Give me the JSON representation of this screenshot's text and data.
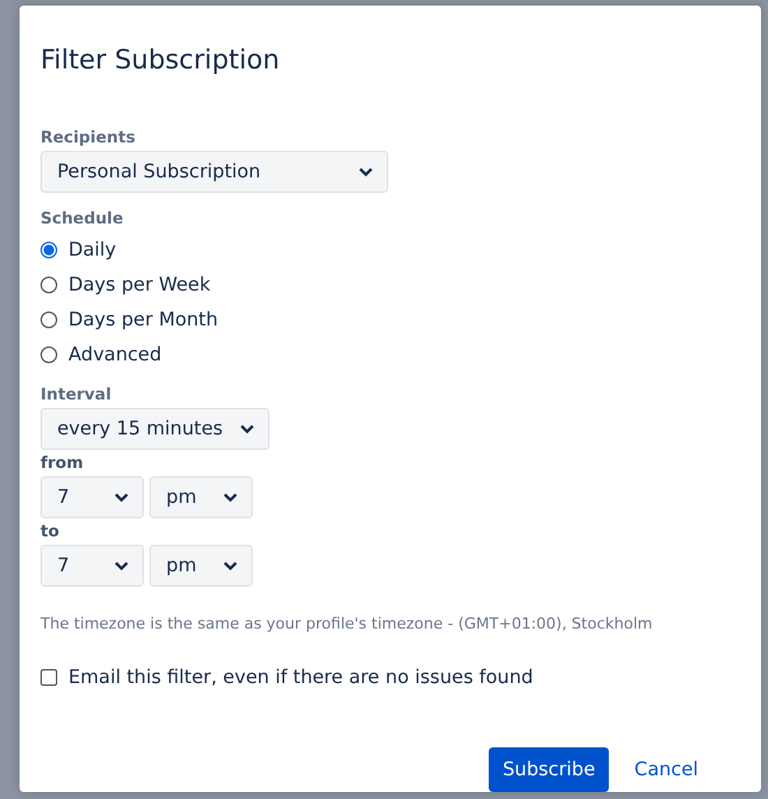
{
  "dialog": {
    "title": "Filter Subscription"
  },
  "recipients": {
    "label": "Recipients",
    "value": "Personal Subscription"
  },
  "schedule": {
    "label": "Schedule",
    "options": [
      {
        "label": "Daily",
        "selected": true
      },
      {
        "label": "Days per Week",
        "selected": false
      },
      {
        "label": "Days per Month",
        "selected": false
      },
      {
        "label": "Advanced",
        "selected": false
      }
    ]
  },
  "interval": {
    "label": "Interval",
    "value": "every 15 minutes"
  },
  "from": {
    "label": "from",
    "hour": "7",
    "ampm": "pm"
  },
  "to": {
    "label": "to",
    "hour": "7",
    "ampm": "pm"
  },
  "timezone_note": "The timezone is the same as your profile's timezone - (GMT+01:00), Stockholm",
  "email_option": {
    "label": "Email this filter, even if there are no issues found",
    "checked": false
  },
  "buttons": [
    {
      "label": "Subscribe",
      "kind": "primary"
    },
    {
      "label": "Cancel",
      "kind": "link"
    }
  ]
}
